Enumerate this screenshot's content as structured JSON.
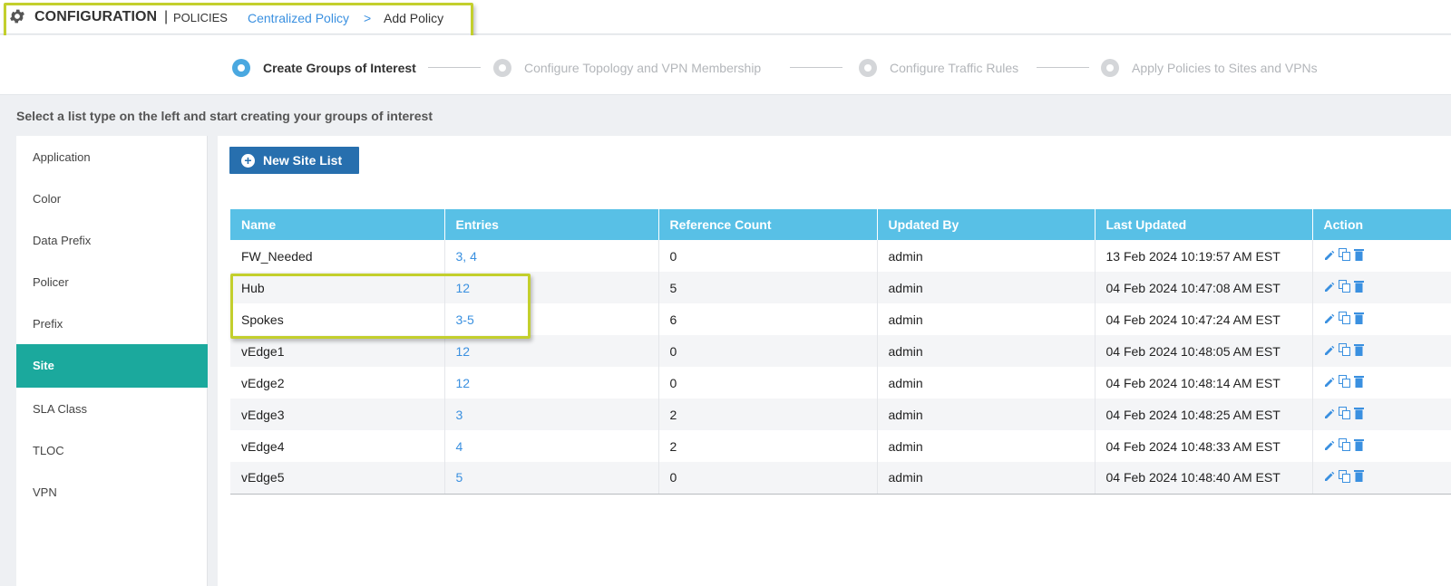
{
  "header": {
    "title": "CONFIGURATION",
    "separator": "|",
    "subtitle": "POLICIES",
    "breadcrumb": "Centralized Policy",
    "arrow": ">",
    "current": "Add Policy"
  },
  "steps": [
    {
      "label": "Create Groups of Interest",
      "state": "active"
    },
    {
      "label": "Configure Topology and VPN Membership",
      "state": "inactive"
    },
    {
      "label": "Configure Traffic Rules",
      "state": "inactive"
    },
    {
      "label": "Apply Policies to Sites and VPNs",
      "state": "inactive"
    }
  ],
  "instruction": "Select a list type on the left and start creating your groups of interest",
  "sidebar": {
    "items": [
      {
        "label": "Application"
      },
      {
        "label": "Color"
      },
      {
        "label": "Data Prefix"
      },
      {
        "label": "Policer"
      },
      {
        "label": "Prefix"
      },
      {
        "label": "Site",
        "active": true
      },
      {
        "label": "SLA Class"
      },
      {
        "label": "TLOC"
      },
      {
        "label": "VPN"
      }
    ]
  },
  "main": {
    "new_button": "New Site List"
  },
  "table": {
    "columns": [
      "Name",
      "Entries",
      "Reference Count",
      "Updated By",
      "Last Updated",
      "Action"
    ],
    "rows": [
      {
        "name": "FW_Needed",
        "entries": "3, 4",
        "ref": "0",
        "by": "admin",
        "updated": "13 Feb 2024 10:19:57 AM EST"
      },
      {
        "name": "Hub",
        "entries": "12",
        "ref": "5",
        "by": "admin",
        "updated": "04 Feb 2024 10:47:08 AM EST"
      },
      {
        "name": "Spokes",
        "entries": "3-5",
        "ref": "6",
        "by": "admin",
        "updated": "04 Feb 2024 10:47:24 AM EST"
      },
      {
        "name": "vEdge1",
        "entries": "12",
        "ref": "0",
        "by": "admin",
        "updated": "04 Feb 2024 10:48:05 AM EST"
      },
      {
        "name": "vEdge2",
        "entries": "12",
        "ref": "0",
        "by": "admin",
        "updated": "04 Feb 2024 10:48:14 AM EST"
      },
      {
        "name": "vEdge3",
        "entries": "3",
        "ref": "2",
        "by": "admin",
        "updated": "04 Feb 2024 10:48:25 AM EST"
      },
      {
        "name": "vEdge4",
        "entries": "4",
        "ref": "2",
        "by": "admin",
        "updated": "04 Feb 2024 10:48:33 AM EST"
      },
      {
        "name": "vEdge5",
        "entries": "5",
        "ref": "0",
        "by": "admin",
        "updated": "04 Feb 2024 10:48:40 AM EST"
      }
    ],
    "actions": [
      {
        "icon": "edit-icon"
      },
      {
        "icon": "copy-icon"
      },
      {
        "icon": "delete-icon"
      }
    ]
  },
  "colors": {
    "accent": "#1ba99d",
    "table_header": "#58c0e6",
    "primary_button": "#276fae",
    "link": "#3a90e0",
    "highlight": "#c3cf2d"
  }
}
